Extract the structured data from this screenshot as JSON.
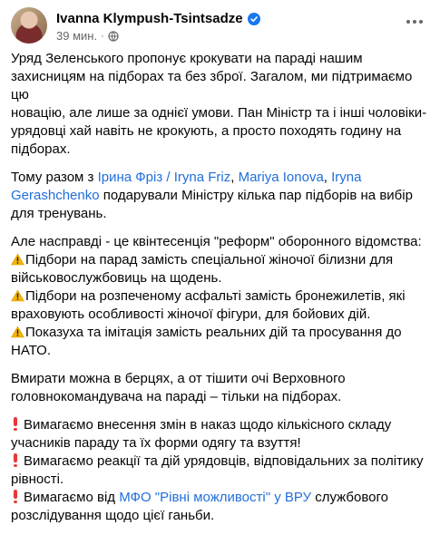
{
  "post": {
    "author": "Ivanna Klympush-Tsintsadze",
    "time": "39 мин.",
    "separator": "·",
    "colors": {
      "link": "#216fdb",
      "verified": "#1877f2",
      "meta": "#65676b"
    },
    "paragraphs": {
      "p1": [
        "Уряд Зеленського пропонує крокувати на параді нашим",
        "захисницям на підборах та без зброї. Загалом, ми підтримаємо цю",
        "новацію, але лише за однієї умови. Пан Міністр та і інші чоловіки-",
        "урядовці хай навіть не крокують, а просто походять годину на",
        "підборах."
      ],
      "p2": {
        "before": "Тому разом з ",
        "link1": "Ірина Фріз / Iryna Friz",
        "sep1": ", ",
        "link2": "Mariya Ionova",
        "sep2": ", ",
        "link3a": "Iryna",
        "link3b": "Gerashchenko",
        "after1": " подарували Міністру кілька пар підборів на вибір",
        "after2": "для тренувань."
      },
      "p3": {
        "intro": "Але насправді - це квінтесенція \"реформ\" оборонного відомства:",
        "b1a": "Підбори на парад замість спеціальної жіночої білизни для",
        "b1b": "військовослужбовиць на щодень.",
        "b2a": "Підбори на розпеченому асфальті замість  бронежилетів, які",
        "b2b": "враховують особливості жіночої фігури, для бойових дій.",
        "b3a": "Показуха та імітація замість реальних дій та просування до",
        "b3b": "НАТО."
      },
      "p4": [
        "Вмирати можна в берцях, а от тішити очі Верховного",
        "головнокомандувача на параді – тільки на підборах."
      ],
      "p5": {
        "d1a": "Вимагаємо внесення змін в наказ щодо кількісного складу",
        "d1b": "учасників параду та їх форми одягу та взуття!",
        "d2a": "Вимагаємо реакції та дій урядовців, відповідальних за політику",
        "d2b": "рівності.",
        "d3_before": "Вимагаємо від ",
        "d3_link": "МФО \"Рівні можливості\" у ВРУ",
        "d3_after": " службового",
        "d3b": "розслідування щодо цієї ганьби."
      }
    }
  }
}
